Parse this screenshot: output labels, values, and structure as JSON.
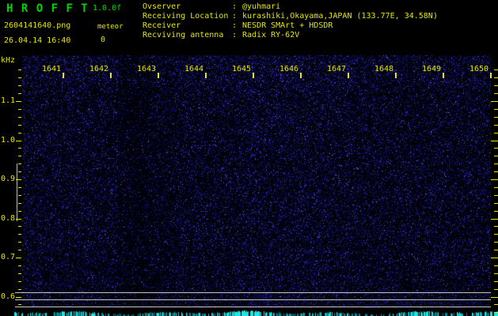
{
  "app": {
    "title": "H R O F F T",
    "version": "1.0.0f",
    "filename": "2604141640.png",
    "datetime": "26.04.14 16:40",
    "meteor_label": "meteor",
    "meteor_count": "0"
  },
  "info": {
    "colon": ":",
    "rows": [
      {
        "label": "Ovserver",
        "value": "@yuhmari"
      },
      {
        "label": "Receiving Location",
        "value": "kurashiki,Okayama,JAPAN (133.77E, 34.58N)"
      },
      {
        "label": "Receiver",
        "value": "NESDR SMArt + HDSDR"
      },
      {
        "label": "Recviving antenna",
        "value": "Radix RY-62V"
      }
    ]
  },
  "chart_data": {
    "type": "heatmap",
    "title": "HROFFT radio meteor observation spectrogram",
    "ylabel": "kHz",
    "y_tick_labels": [
      "1.1",
      "1.0",
      "0.9",
      "0.8",
      "0.7",
      "0.6"
    ],
    "y_range_khz": [
      0.57,
      1.19
    ],
    "x_tick_labels": [
      "1641",
      "1642",
      "1643",
      "1644",
      "1645",
      "1646",
      "1647",
      "1648",
      "1649",
      "1650"
    ],
    "x_axis_note": "time of day hhmm, one-minute divisions, 10-minute window",
    "content": "uniform dark-blue background noise only; no meteor echo traces visible",
    "meteor_count": 0,
    "reference_lines_khz": [
      0.61,
      0.59,
      0.575
    ],
    "marker_bar_khz_span": [
      0.8,
      0.95
    ],
    "signal_strip": "cyan signal-level bars along the bottom edge",
    "legend_position": "none",
    "grid": false
  },
  "colors": {
    "background": "#000000",
    "title_green": "#00d400",
    "text_yellow": "#e6e600",
    "noise_blue": "#1c1ca0",
    "noise_bright_blue": "#4848ff",
    "reference_gray": "#c4c4c4",
    "strip_cyan": "#00e0e0"
  }
}
